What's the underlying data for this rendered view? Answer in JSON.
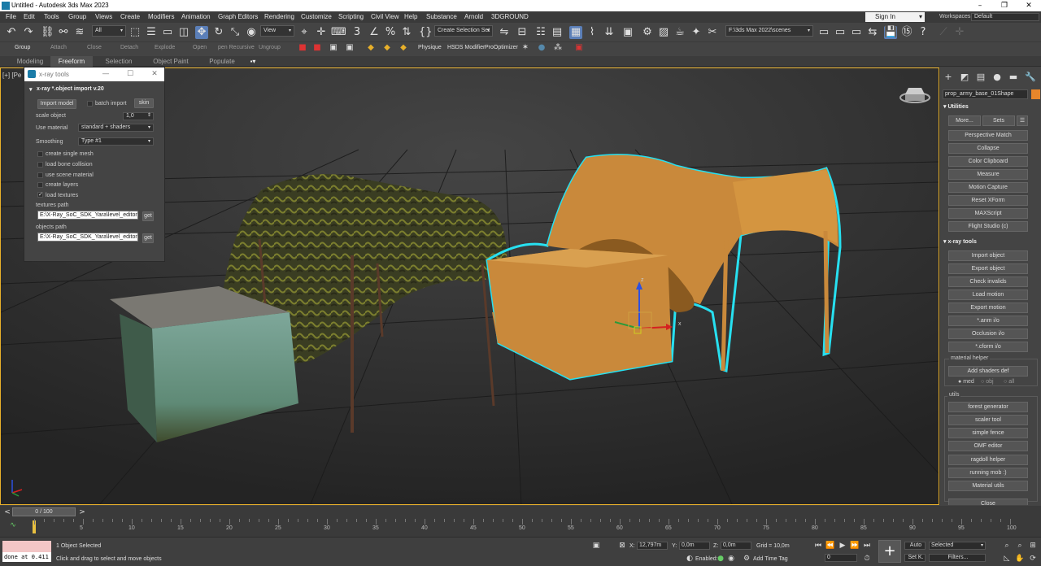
{
  "window": {
    "title": "Untitled - Autodesk 3ds Max 2023",
    "minimize": "–",
    "maximize": "❐",
    "close": "✕"
  },
  "menu": [
    "File",
    "Edit",
    "Tools",
    "Group",
    "Views",
    "Create",
    "Modifiers",
    "Animation",
    "Graph Editors",
    "Rendering",
    "Customize",
    "Scripting",
    "Civil View",
    "Help",
    "Substance",
    "Arnold",
    "3DGROUND"
  ],
  "signin": {
    "label": "Sign In"
  },
  "workspace": {
    "label": "Workspaces:",
    "value": "Default"
  },
  "toolbar": {
    "filter": "All",
    "refcoord": "View",
    "selset": "Create Selection Set",
    "path": "F:\\3ds Max 2022\\scenes"
  },
  "toolbar2": {
    "labels": [
      "Group",
      "Attach",
      "Close",
      "Detach",
      "Explode",
      "Open",
      "pen Recursive",
      "Ungroup"
    ],
    "physique": "Physique",
    "hsds": "HSDS Modifier",
    "proopt": "ProOptimizer"
  },
  "ribbon_tabs": [
    "Modeling",
    "Freeform",
    "Selection",
    "Object Paint",
    "Populate"
  ],
  "viewport": {
    "label": "[+] [Pe"
  },
  "dialog": {
    "title": "x-ray tools",
    "rollout": "x-ray *.object import v.20",
    "import_model": "Import model",
    "batch_import": "batch import",
    "skin": "skin",
    "scale_label": "scale object",
    "scale_value": "1,0",
    "material_label": "Use material",
    "material_value": "standard + shaders",
    "smoothing_label": "Smoothing",
    "smoothing_value": "Type #1",
    "checkboxes": [
      {
        "label": "create single mesh",
        "checked": false
      },
      {
        "label": "load bone collision",
        "checked": false
      },
      {
        "label": "use scene material",
        "checked": false
      },
      {
        "label": "create layers",
        "checked": false
      },
      {
        "label": "load textures",
        "checked": true
      }
    ],
    "textures_label": "textures path",
    "textures_value": "E:\\X-Ray_SoC_SDK_Yara\\level_editor\\ga",
    "objects_label": "objects path",
    "objects_value": "E:\\X-Ray_SoC_SDK_Yara\\level_editor\\ra",
    "get": "get"
  },
  "cmdpanel": {
    "object_name": "prop_army_base_01Shape",
    "object_color": "#e7862b",
    "utilities_head": "Utilities",
    "more": "More...",
    "sets": "Sets",
    "utility_buttons": [
      "Perspective Match",
      "Collapse",
      "Color Clipboard",
      "Measure",
      "Motion Capture",
      "Reset XForm",
      "MAXScript",
      "Flight Studio (c)"
    ],
    "xray_head": "x-ray tools",
    "xray_buttons": [
      "Import object",
      "Export object",
      "Check invalids",
      "Load motion",
      "Export motion",
      "*.anm i/o",
      "Occlusion i/o",
      "*.cform i/o"
    ],
    "material_helper": "material helper",
    "add_shaders": "Add shaders def",
    "radios": [
      "med",
      "obj",
      "all"
    ],
    "utils_label": "utils",
    "utils_buttons": [
      "forest generator",
      "scaler tool",
      "simple fence",
      "OMF editor",
      "ragdoll helper",
      "running mob :)",
      "Material utils"
    ],
    "close": "Close"
  },
  "timeline": {
    "range": "0 / 100",
    "ticks": [
      "5",
      "10",
      "15",
      "20",
      "25",
      "30",
      "35",
      "40",
      "45",
      "50",
      "55",
      "60",
      "65",
      "70",
      "75",
      "80",
      "85",
      "90",
      "95",
      "100"
    ]
  },
  "status": {
    "maxscript_output": "done at 0.411",
    "selected": "1 Object Selected",
    "prompt": "Click and drag to select and move objects",
    "x_label": "X:",
    "x": "12,797m",
    "y_label": "Y:",
    "y": "0,0m",
    "z_label": "Z:",
    "z": "0,0m",
    "grid": "Grid = 10,0m",
    "enabled": "Enabled:",
    "add_time_tag": "Add Time Tag",
    "auto": "Auto",
    "setk": "Set K.",
    "selected_dd": "Selected",
    "filters": "Filters...",
    "frame": "0"
  }
}
